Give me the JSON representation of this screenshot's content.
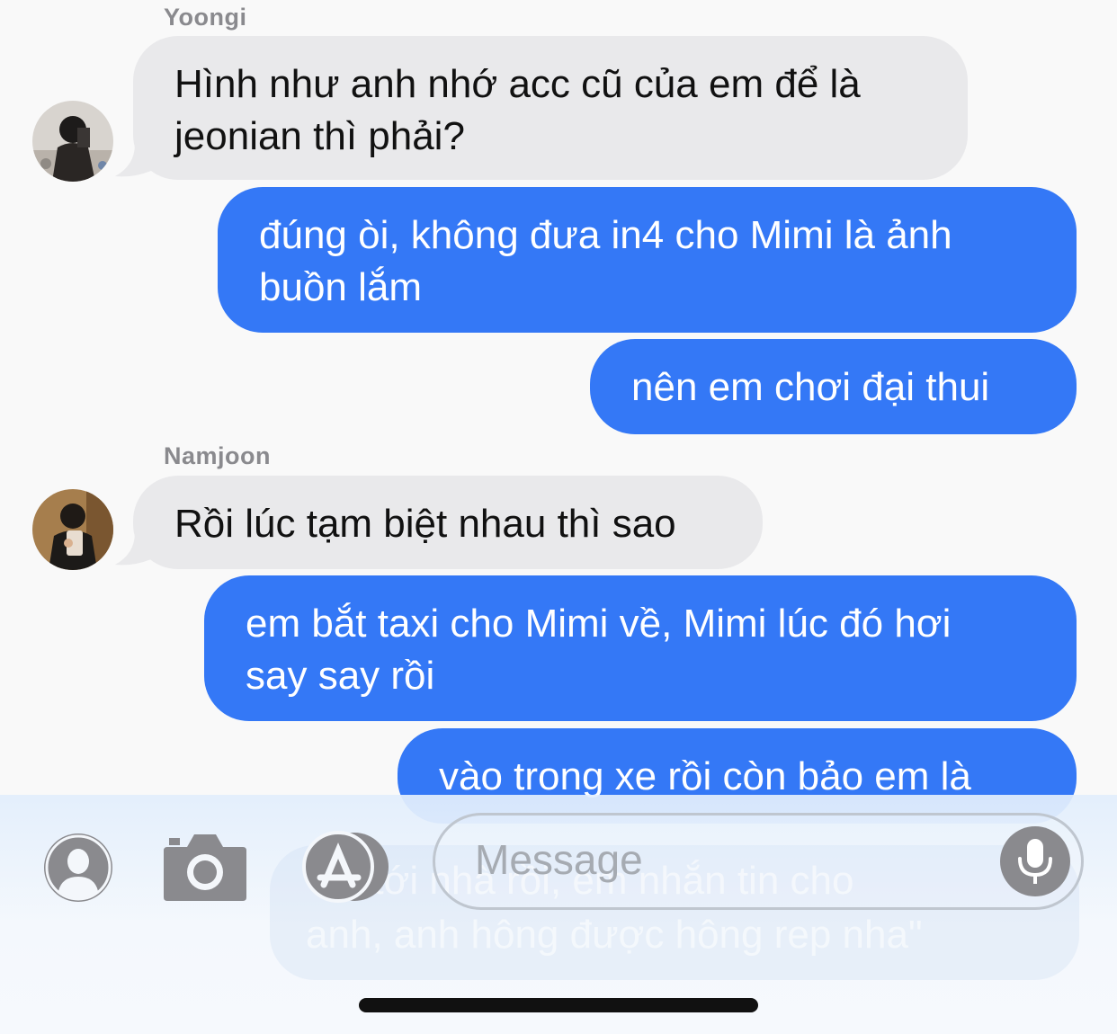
{
  "messages": {
    "m1": {
      "sender": "Yoongi",
      "text": "Hình như anh nhớ acc cũ của em để là\njeonian thì phải?"
    },
    "m2": {
      "text": "đúng òi, không đưa in4 cho Mimi là ảnh\nbuồn lắm"
    },
    "m3": {
      "text": "nên em chơi đại thui"
    },
    "m4": {
      "sender": "Namjoon",
      "text": "Rồi lúc tạm biệt nhau thì sao"
    },
    "m5": {
      "text": "em bắt taxi cho Mimi về, Mimi lúc đó hơi\nsay say rồi"
    },
    "m6": {
      "text": "vào trong xe rồi còn bảo em là"
    }
  },
  "ghost_text": "\"về tới nhà rồi, em nhắn tin cho\nanh, anh hông được hông rep nha\"",
  "composer": {
    "placeholder": "Message",
    "icons": [
      "contact-icon",
      "camera-icon",
      "app-store-icon",
      "microphone-icon"
    ]
  },
  "colors": {
    "outgoing": "#3478f6",
    "incoming": "#e9e9eb",
    "background": "#f9f9f9"
  }
}
